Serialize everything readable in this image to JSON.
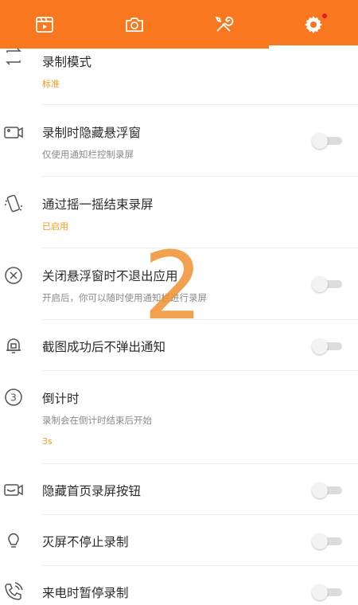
{
  "tabs": [
    {
      "icon": "video-clip-icon"
    },
    {
      "icon": "camera-icon"
    },
    {
      "icon": "tools-icon"
    },
    {
      "icon": "settings-gear-icon",
      "active": true,
      "has_badge": true
    }
  ],
  "settings": {
    "record_mode": {
      "title": "录制模式",
      "value": "标准"
    },
    "hide_float": {
      "title": "录制时隐藏悬浮窗",
      "subtitle": "仅使用通知栏控制录屏"
    },
    "shake_stop": {
      "title": "通过摇一摇结束录屏",
      "value": "已启用"
    },
    "close_float": {
      "title": "关闭悬浮窗时不退出应用",
      "subtitle": "开启后，你可以随时使用通知栏进行录屏"
    },
    "screenshot_notify": {
      "title": "截图成功后不弹出通知"
    },
    "countdown": {
      "title": "倒计时",
      "subtitle": "录制会在倒计时结束后开始",
      "value": "3s"
    },
    "hide_home_button": {
      "title": "隐藏首页录屏按钮"
    },
    "screen_off": {
      "title": "灭屏不停止录制"
    },
    "call_pause": {
      "title": "来电时暂停录制"
    }
  },
  "overlay": {
    "countdown_number": "2"
  },
  "colors": {
    "accent": "#f9771f",
    "value_text": "#f39a1e"
  }
}
